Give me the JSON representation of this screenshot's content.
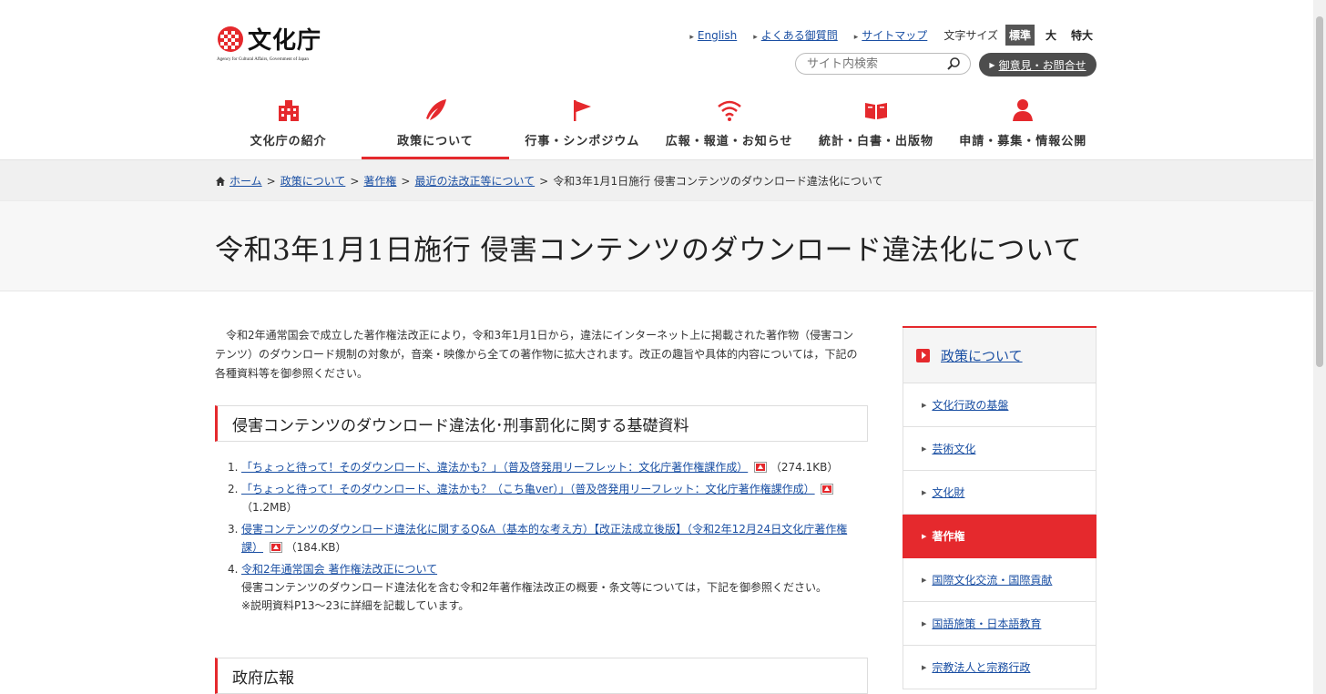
{
  "site": {
    "logo_text": "文化庁",
    "logo_sub": "Agency for Cultural Affairs, Government of Japan"
  },
  "utility": {
    "links": [
      "English",
      "よくある御質問",
      "サイトマップ"
    ],
    "font_size_label": "文字サイズ",
    "font_sizes": [
      "標準",
      "大",
      "特大"
    ],
    "search_placeholder": "サイト内検索",
    "contact": "御意見・お問合せ"
  },
  "nav": {
    "items": [
      "文化庁の紹介",
      "政策について",
      "行事・シンポジウム",
      "広報・報道・お知らせ",
      "統計・白書・出版物",
      "申請・募集・情報公開"
    ],
    "active": "政策について"
  },
  "breadcrumb": {
    "items": [
      "ホーム",
      "政策について",
      "著作権",
      "最近の法改正等について"
    ],
    "current": "令和3年1月1日施行 侵害コンテンツのダウンロード違法化について"
  },
  "page": {
    "title": "令和3年1月1日施行 侵害コンテンツのダウンロード違法化について",
    "intro": "令和2年通常国会で成立した著作権法改正により，令和3年1月1日から，違法にインターネット上に掲載された著作物（侵害コンテンツ）のダウンロード規制の対象が，音楽・映像から全ての著作物に拡大されます。改正の趣旨や具体的内容については，下記の各種資料等を御参照ください。"
  },
  "section1": {
    "heading": "侵害コンテンツのダウンロード違法化･刑事罰化に関する基礎資料",
    "items": [
      {
        "num": "1.",
        "link": "「ちょっと待って！そのダウンロード、違法かも？」（普及啓発用リーフレット：文化庁著作権課作成）",
        "size": "（274.1KB）"
      },
      {
        "num": "2.",
        "link": "「ちょっと待って！そのダウンロード、違法かも？（こち亀ver）」（普及啓発用リーフレット：文化庁著作権課作成）",
        "size": "（1.2MB）"
      },
      {
        "num": "3.",
        "link": "侵害コンテンツのダウンロード違法化に関するQ&A（基本的な考え方）【改正法成立後版】（令和2年12月24日文化庁著作権課）",
        "size": "（184.KB）"
      },
      {
        "num": "4.",
        "link": "令和2年通常国会 著作権法改正について",
        "desc": "侵害コンテンツのダウンロード違法化を含む令和2年著作権法改正の概要・条文等については，下記を御参照ください。",
        "note": "※説明資料P13～23に詳細を記載しています。"
      }
    ]
  },
  "section2": {
    "heading": "政府広報"
  },
  "sidebar": {
    "heading": "政策について",
    "items": [
      "文化行政の基盤",
      "芸術文化",
      "文化財",
      "著作権",
      "国際文化交流・国際貢献",
      "国語施策・日本語教育",
      "宗教法人と宗務行政"
    ],
    "active": "著作権"
  },
  "colors": {
    "accent": "#e5292d",
    "link": "#1a4fa3",
    "dark_button": "#4d4d4d"
  }
}
